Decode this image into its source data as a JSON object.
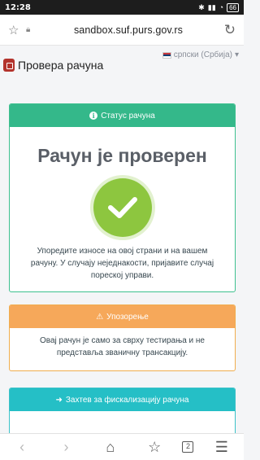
{
  "statusbar": {
    "time": "12:28",
    "battery": "66"
  },
  "browser": {
    "url": "sandbox.suf.purs.gov.rs",
    "tabs_count": "2"
  },
  "header": {
    "title": "Провера рачуна",
    "language": "српски (Србија)"
  },
  "status_card": {
    "heading": "Статус рачуна",
    "title": "Рачун је проверен",
    "text": "Упоредите износе на овој страни и на вашем рачуну. У случају неједнакости, пријавите случај пореској управи.",
    "accent": "#34b88a"
  },
  "warning_card": {
    "heading": "Упозорење",
    "text": "Овај рачун је само за сврху тестирања и не представља званичну трансакцију.",
    "accent": "#f6a85a"
  },
  "request_card": {
    "heading": "Захтев за фискализацију рачуна",
    "accent": "#25bfc6"
  }
}
